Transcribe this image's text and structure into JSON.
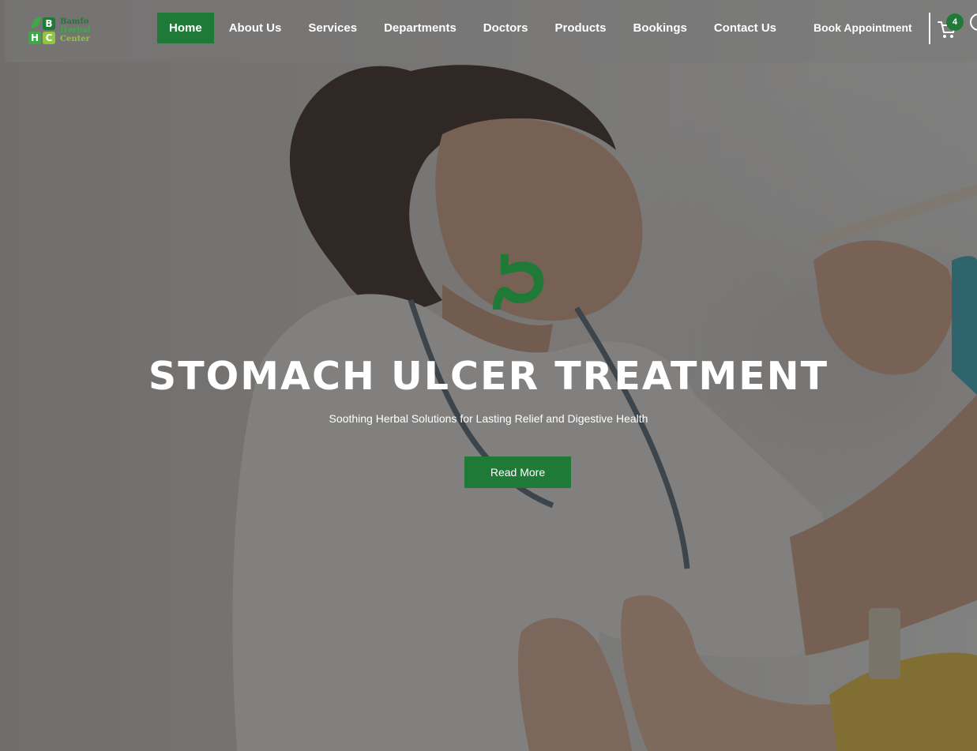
{
  "logo": {
    "letters": [
      "B",
      "H",
      "C"
    ],
    "name_lines": [
      "Bamfo",
      "Herbal",
      "Center"
    ]
  },
  "nav": {
    "items": [
      {
        "label": "Home",
        "active": true
      },
      {
        "label": "About Us"
      },
      {
        "label": "Services"
      },
      {
        "label": "Departments"
      },
      {
        "label": "Doctors"
      },
      {
        "label": "Products"
      },
      {
        "label": "Bookings"
      },
      {
        "label": "Contact Us"
      }
    ],
    "book_label": "Book Appointment",
    "cart_count": "4"
  },
  "hero": {
    "icon": "stomach-icon",
    "title": "STOMACH ULCER TREATMENT",
    "subtitle": "Soothing Herbal Solutions for Lasting Relief and Digestive Health",
    "button_label": "Read More"
  },
  "colors": {
    "brand_green": "#1f7a37",
    "light_green": "#8dc63f",
    "text": "#ffffff"
  }
}
